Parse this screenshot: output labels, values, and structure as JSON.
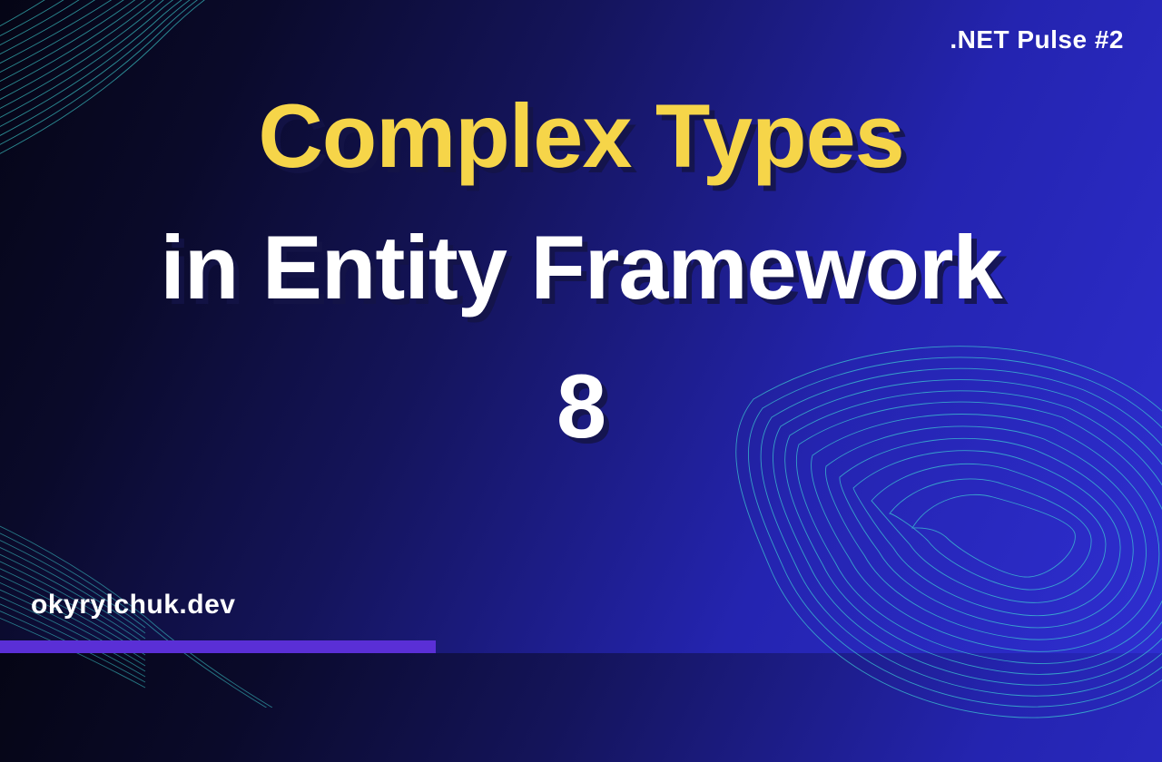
{
  "header": {
    "tag": ".NET Pulse #2"
  },
  "title": {
    "line1": "Complex Types",
    "line2": "in Entity Framework",
    "line3": "8"
  },
  "footer": {
    "site": "okyrylchuk.dev"
  },
  "colors": {
    "accent_yellow": "#f6d549",
    "accent_purple": "#5a2fd6",
    "mesh": "#3fd4d4"
  }
}
